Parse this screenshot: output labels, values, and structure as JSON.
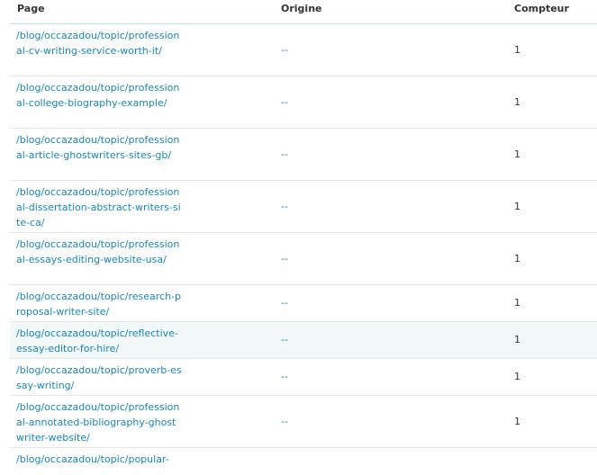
{
  "table": {
    "columns": {
      "page": "Page",
      "origin": "Origine",
      "count": "Compteur"
    },
    "rows": [
      {
        "page": "/blog/occazadou/topic/professional-cv-writing-service-worth-it/",
        "origin": "--",
        "count": "1"
      },
      {
        "page": "/blog/occazadou/topic/professional-college-biography-example/",
        "origin": "--",
        "count": "1"
      },
      {
        "page": "/blog/occazadou/topic/professional-article-ghostwriters-sites-gb/",
        "origin": "--",
        "count": "1"
      },
      {
        "page": "/blog/occazadou/topic/professional-dissertation-abstract-writers-site-ca/",
        "origin": "--",
        "count": "1"
      },
      {
        "page": "/blog/occazadou/topic/professional-essays-editing-website-usa/",
        "origin": "--",
        "count": "1"
      },
      {
        "page": "/blog/occazadou/topic/research-proposal-writer-site/",
        "origin": "--",
        "count": "1"
      },
      {
        "page": "/blog/occazadou/topic/reflective-essay-editor-for-hire/",
        "origin": "--",
        "count": "1"
      },
      {
        "page": "/blog/occazadou/topic/proverb-essay-writing/",
        "origin": "--",
        "count": "1"
      },
      {
        "page": "/blog/occazadou/topic/professional-annotated-bibliography-ghostwriter-website/",
        "origin": "--",
        "count": "1"
      },
      {
        "page": "/blog/occazadou/topic/popular-",
        "origin": "",
        "count": ""
      }
    ]
  }
}
